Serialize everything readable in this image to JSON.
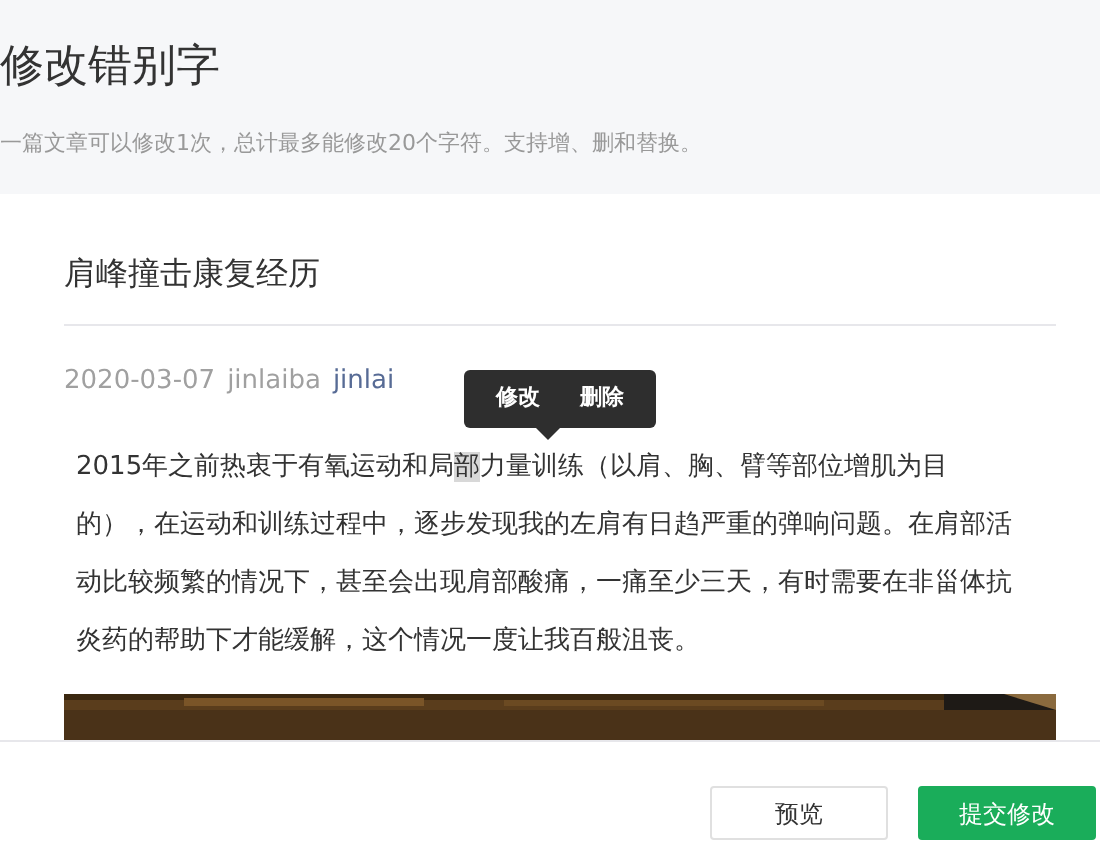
{
  "header": {
    "title": "修改错别字",
    "hint": "一篇文章可以修改1次，总计最多能修改20个字符。支持增、删和替换。"
  },
  "article": {
    "title": "肩峰撞击康复经历",
    "date": "2020-03-07",
    "author": "jinlaiba",
    "account": "jinlai",
    "paragraph": [
      {
        "text": "2015年之前热衷于有氧运动和局",
        "selected": false
      },
      {
        "text": "部",
        "selected": true
      },
      {
        "text": "力量训练（以肩、胸、臂等部位增肌为目的），在运动和训练过程中，逐步发现我的左肩有日趋严重的弹响问题。在肩部活动比较频繁的情况下，甚至会出现肩部酸痛，一痛至少三天，有时需要在非甾体抗炎药的帮助下才能缓解，这个情况一度让我百般沮丧。",
        "selected": false
      }
    ]
  },
  "tooltip": {
    "actions": [
      "修改",
      "删除"
    ]
  },
  "buttons": [
    {
      "label": "预览",
      "kind": "secondary"
    },
    {
      "label": "提交修改",
      "kind": "primary"
    }
  ]
}
